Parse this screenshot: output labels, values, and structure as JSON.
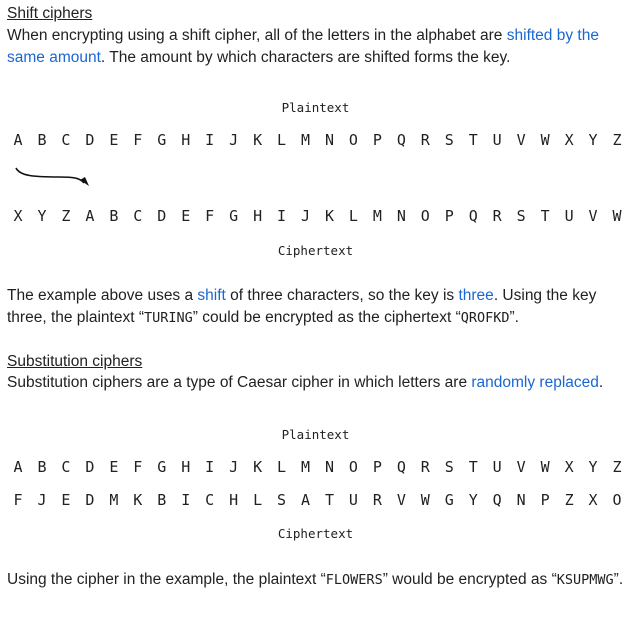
{
  "shift_section": {
    "heading": "Shift ciphers",
    "intro": {
      "part1": "When encrypting using a shift cipher, all of the letters in the alphabet are ",
      "link1": "shifted by the same amount",
      "part2": ". The amount by which characters are shifted forms the key."
    },
    "diagram": {
      "plaintext_label": "Plaintext",
      "ciphertext_label": "Ciphertext",
      "plaintext_letters": [
        "A",
        "B",
        "C",
        "D",
        "E",
        "F",
        "G",
        "H",
        "I",
        "J",
        "K",
        "L",
        "M",
        "N",
        "O",
        "P",
        "Q",
        "R",
        "S",
        "T",
        "U",
        "V",
        "W",
        "X",
        "Y",
        "Z"
      ],
      "ciphertext_letters": [
        "X",
        "Y",
        "Z",
        "A",
        "B",
        "C",
        "D",
        "E",
        "F",
        "G",
        "H",
        "I",
        "J",
        "K",
        "L",
        "M",
        "N",
        "O",
        "P",
        "Q",
        "R",
        "S",
        "T",
        "U",
        "V",
        "W"
      ],
      "arrow_icon": "curved-arrow-right"
    },
    "explanation": {
      "part1": "The example above uses a ",
      "link1": "shift",
      "part2": " of three characters, so the key is ",
      "link2": "three",
      "part3": ". Using the key three, the plaintext “",
      "code1": "TURING",
      "part4": "” could be encrypted as the ciphertext “",
      "code2": "QROFKD",
      "part5": "”."
    }
  },
  "substitution_section": {
    "heading": "Substitution ciphers",
    "intro": {
      "part1": "Substitution ciphers are a type of Caesar cipher in which letters are ",
      "link1": "randomly replaced",
      "part2": "."
    },
    "diagram": {
      "plaintext_label": "Plaintext",
      "ciphertext_label": "Ciphertext",
      "plaintext_letters": [
        "A",
        "B",
        "C",
        "D",
        "E",
        "F",
        "G",
        "H",
        "I",
        "J",
        "K",
        "L",
        "M",
        "N",
        "O",
        "P",
        "Q",
        "R",
        "S",
        "T",
        "U",
        "V",
        "W",
        "X",
        "Y",
        "Z"
      ],
      "ciphertext_letters": [
        "F",
        "J",
        "E",
        "D",
        "M",
        "K",
        "B",
        "I",
        "C",
        "H",
        "L",
        "S",
        "A",
        "T",
        "U",
        "R",
        "V",
        "W",
        "G",
        "Y",
        "Q",
        "N",
        "P",
        "Z",
        "X",
        "O"
      ]
    },
    "example": {
      "part1": "Using the cipher in the example, the plaintext “",
      "code1": "FLOWERS",
      "part2": "” would be encrypted as “",
      "code2": "KSUPMWG",
      "part3": "”."
    }
  },
  "colors": {
    "link": "#1a66d2",
    "text": "#202124"
  }
}
